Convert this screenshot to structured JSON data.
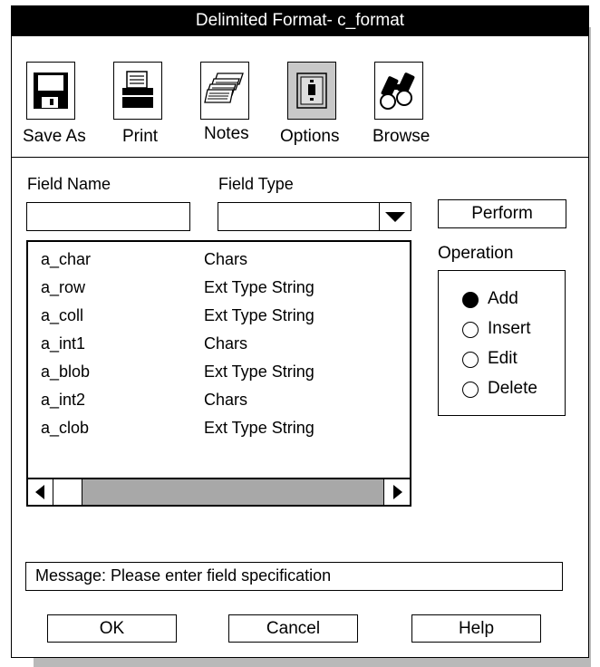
{
  "window": {
    "title": "Delimited Format- c_format"
  },
  "toolbar": {
    "items": [
      {
        "label": "Save As",
        "icon": "floppy-disk-icon"
      },
      {
        "label": "Print",
        "icon": "printer-icon"
      },
      {
        "label": "Notes",
        "icon": "notes-stack-icon"
      },
      {
        "label": "Options",
        "icon": "options-panel-icon"
      },
      {
        "label": "Browse",
        "icon": "binoculars-icon"
      }
    ]
  },
  "form": {
    "field_name_label": "Field Name",
    "field_type_label": "Field Type",
    "field_name_value": "",
    "field_type_value": ""
  },
  "perform_button": "Perform",
  "fields_list": {
    "rows": [
      {
        "name": "a_char",
        "type": "Chars"
      },
      {
        "name": "a_row",
        "type": "Ext Type String"
      },
      {
        "name": "a_coll",
        "type": "Ext Type String"
      },
      {
        "name": "a_int1",
        "type": "Chars"
      },
      {
        "name": "a_blob",
        "type": "Ext Type String"
      },
      {
        "name": "a_int2",
        "type": "Chars"
      },
      {
        "name": "a_clob",
        "type": "Ext Type String"
      }
    ]
  },
  "operation": {
    "label": "Operation",
    "options": [
      {
        "label": "Add",
        "selected": true
      },
      {
        "label": "Insert",
        "selected": false
      },
      {
        "label": "Edit",
        "selected": false
      },
      {
        "label": "Delete",
        "selected": false
      }
    ]
  },
  "message": "Message: Please enter field specification",
  "buttons": {
    "ok": "OK",
    "cancel": "Cancel",
    "help": "Help"
  }
}
